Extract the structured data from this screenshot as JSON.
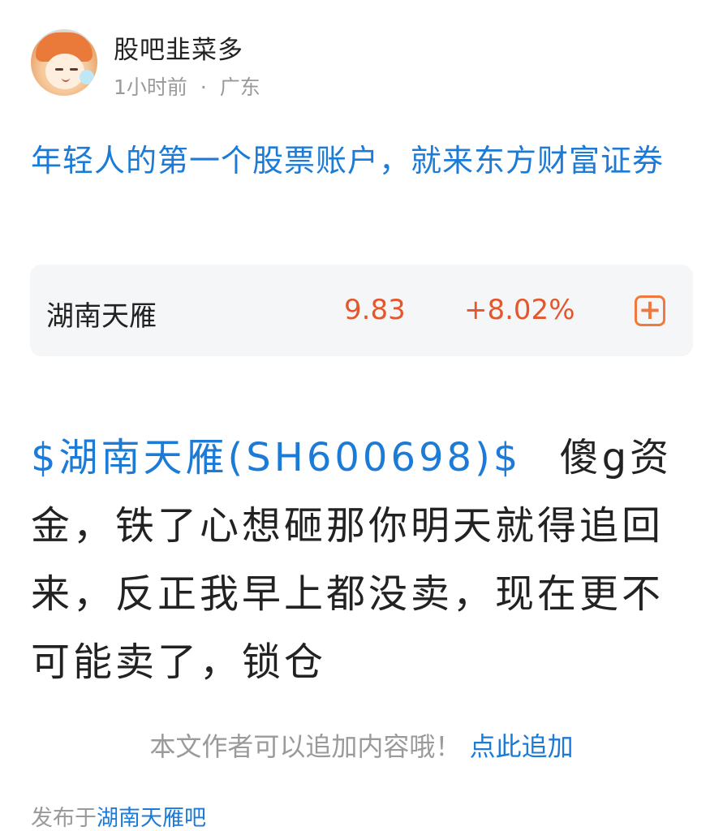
{
  "author": {
    "name": "股吧韭菜多",
    "time": "1小时前",
    "separator": "·",
    "location": "广东"
  },
  "ad": {
    "text": "年轻人的第一个股票账户，就来东方财富证券"
  },
  "stock_card": {
    "name": "湖南天雁",
    "price": "9.83",
    "change": "+8.02%",
    "price_color": "#e4572e",
    "add_icon": "plus-square-icon"
  },
  "post": {
    "stock_tag": "$湖南天雁(SH600698)$",
    "text": "傻g资金，铁了心想砸那你明天就得追回来，反正我早上都没卖，现在更不可能卖了，锁仓"
  },
  "append_hint": {
    "text": "本文作者可以追加内容哦！",
    "link": "点此追加"
  },
  "footer": {
    "prefix": "发布于",
    "forum": "湖南天雁吧"
  },
  "colors": {
    "link": "#1c7bd6",
    "up": "#e4572e",
    "muted": "#9a9a9a"
  }
}
